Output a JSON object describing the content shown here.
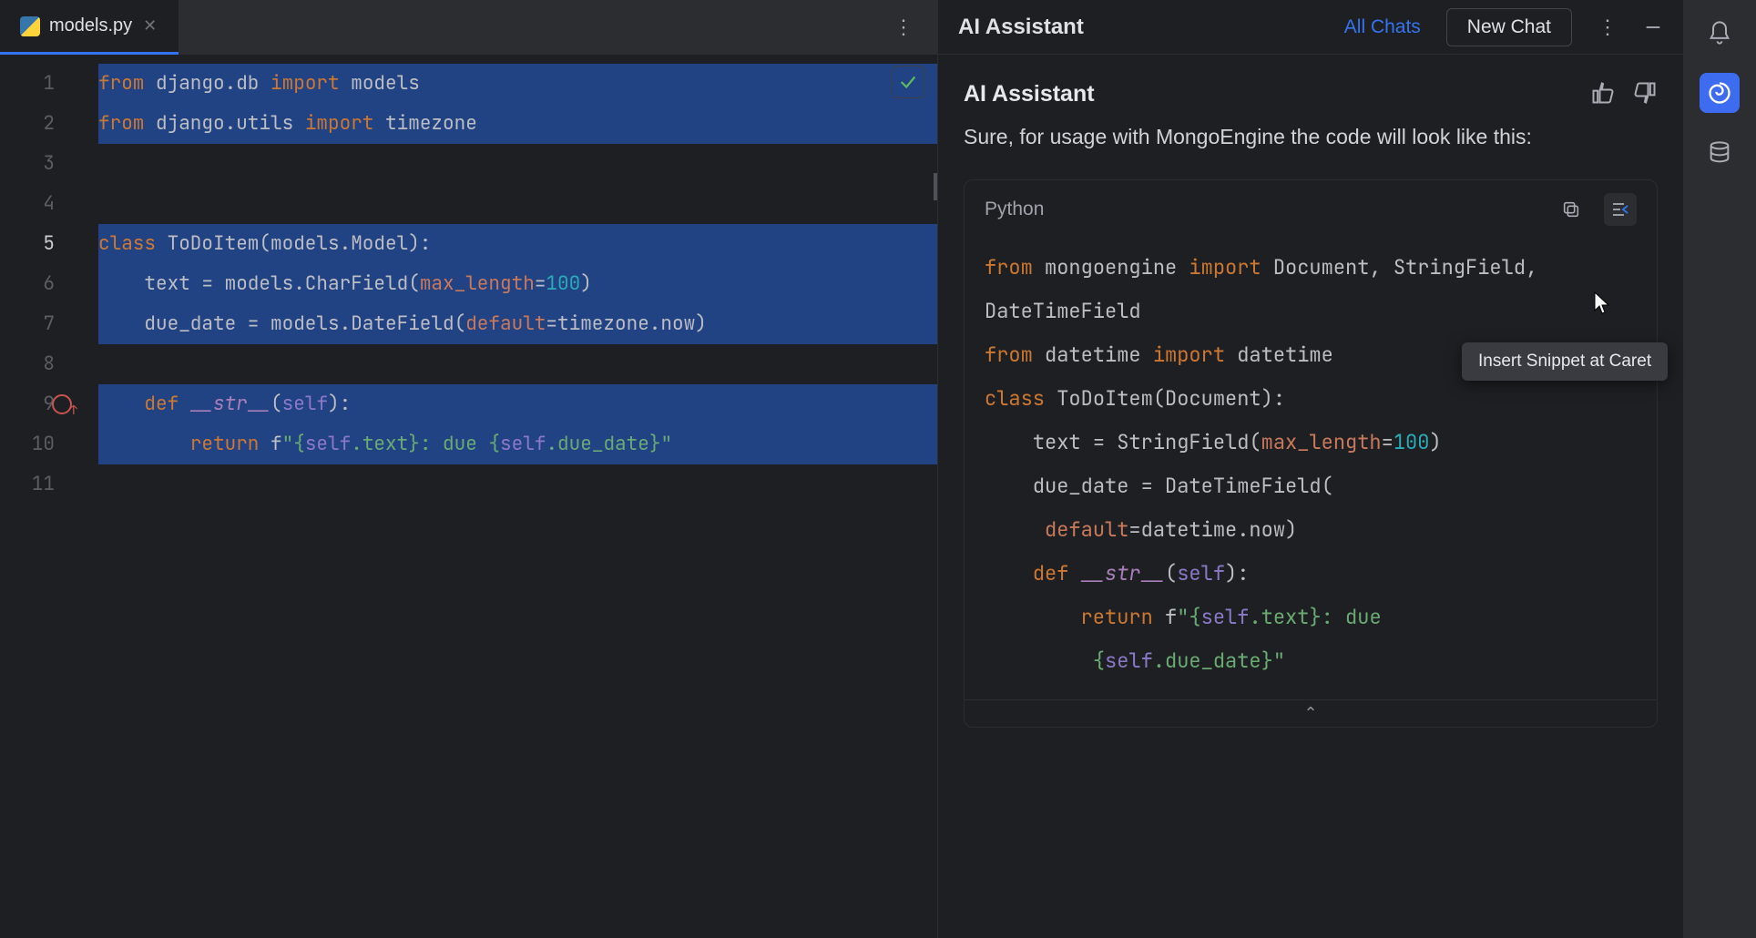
{
  "editor": {
    "filename": "models.py",
    "line_numbers": [
      "1",
      "2",
      "3",
      "4",
      "5",
      "6",
      "7",
      "8",
      "9",
      "10",
      "11"
    ],
    "active_line": 5,
    "override_line": 9,
    "code_tokens": [
      [
        [
          "kw",
          "from"
        ],
        [
          "",
          " django.db "
        ],
        [
          "kw",
          "import"
        ],
        [
          "",
          " models"
        ]
      ],
      [
        [
          "kw",
          "from"
        ],
        [
          "",
          " django.utils "
        ],
        [
          "kw",
          "import"
        ],
        [
          "",
          " timezone"
        ]
      ],
      [
        [
          "",
          ""
        ]
      ],
      [
        [
          "",
          ""
        ]
      ],
      [
        [
          "kw",
          "class"
        ],
        [
          "",
          " ToDoItem(models.Model):"
        ]
      ],
      [
        [
          "",
          "    text = models.CharField("
        ],
        [
          "param",
          "max_length"
        ],
        [
          "",
          "="
        ],
        [
          "num",
          "100"
        ],
        [
          "",
          ")"
        ]
      ],
      [
        [
          "",
          "    due_date = models.DateField("
        ],
        [
          "param",
          "default"
        ],
        [
          "",
          "=timezone.now)"
        ]
      ],
      [
        [
          "",
          ""
        ]
      ],
      [
        [
          "",
          "    "
        ],
        [
          "kw",
          "def"
        ],
        [
          "",
          " "
        ],
        [
          "fn",
          "__str__"
        ],
        [
          "",
          "("
        ],
        [
          "self",
          "self"
        ],
        [
          "",
          "):"
        ]
      ],
      [
        [
          "",
          "        "
        ],
        [
          "kw",
          "return"
        ],
        [
          "",
          " f"
        ],
        [
          "str",
          "\"{"
        ],
        [
          "self",
          "self"
        ],
        [
          "str",
          ".text}: due {"
        ],
        [
          "self",
          "self"
        ],
        [
          "str",
          ".due_date}\""
        ]
      ],
      [
        [
          "",
          ""
        ]
      ]
    ],
    "selection_lines": [
      1,
      2,
      3,
      4,
      5,
      6,
      7,
      8,
      9,
      10
    ]
  },
  "ai": {
    "panel_title": "AI Assistant",
    "all_chats": "All Chats",
    "new_chat": "New Chat",
    "message_title": "AI Assistant",
    "message_body": "Sure, for usage with MongoEngine the code will look like this:",
    "snippet_lang": "Python",
    "snippet_tokens": [
      [
        [
          "kw",
          "from"
        ],
        [
          "",
          " mongoengine "
        ],
        [
          "kw",
          "import"
        ],
        [
          "",
          " Document, StringField, DateTimeField"
        ]
      ],
      [
        [
          "kw",
          "from"
        ],
        [
          "",
          " datetime "
        ],
        [
          "kw",
          "import"
        ],
        [
          "",
          " datetime"
        ]
      ],
      [
        [
          "",
          ""
        ]
      ],
      [
        [
          "",
          ""
        ]
      ],
      [
        [
          "kw",
          "class"
        ],
        [
          "",
          " ToDoItem(Document):"
        ]
      ],
      [
        [
          "",
          "    text = StringField("
        ],
        [
          "param",
          "max_length"
        ],
        [
          "",
          "="
        ],
        [
          "num",
          "100"
        ],
        [
          "",
          ")"
        ]
      ],
      [
        [
          "",
          "    due_date = DateTimeField("
        ]
      ],
      [
        [
          "",
          "     "
        ],
        [
          "param",
          "default"
        ],
        [
          "",
          "=datetime.now)"
        ]
      ],
      [
        [
          "",
          ""
        ]
      ],
      [
        [
          "",
          "    "
        ],
        [
          "kw",
          "def"
        ],
        [
          "",
          " "
        ],
        [
          "fn",
          "__str__"
        ],
        [
          "",
          "("
        ],
        [
          "self",
          "self"
        ],
        [
          "",
          "):"
        ]
      ],
      [
        [
          "",
          "        "
        ],
        [
          "kw",
          "return"
        ],
        [
          "",
          " f"
        ],
        [
          "str",
          "\"{"
        ],
        [
          "self",
          "self"
        ],
        [
          "str",
          ".text}: due"
        ]
      ],
      [
        [
          "str",
          "         {"
        ],
        [
          "self",
          "self"
        ],
        [
          "str",
          ".due_date}\""
        ]
      ]
    ],
    "tooltip": "Insert Snippet at Caret"
  }
}
